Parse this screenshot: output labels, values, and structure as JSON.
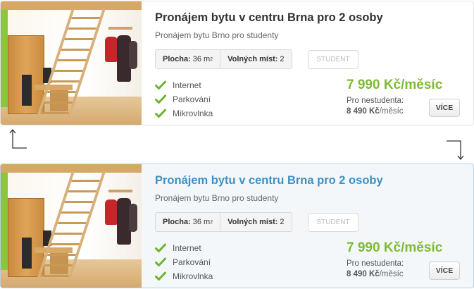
{
  "listings": [
    {
      "state": "normal",
      "title": "Pronájem bytu v centru Brna pro 2 osoby",
      "subtitle": "Pronájem bytu Brno pro studenty",
      "specs": {
        "area_label": "Plocha:",
        "area_value": "36 m",
        "area_unit_sup": "2",
        "free_label": "Volných míst:",
        "free_value": "2"
      },
      "badge": "STUDENT",
      "amenities": [
        "Internet",
        "Parkování",
        "Mikrovlnka"
      ],
      "price": "7 990 Kč/měsíc",
      "nonstudent_label": "Pro nestudenta:",
      "nonstudent_price": "8 490 Kč",
      "nonstudent_suffix": "/měsíc",
      "more_button": "VÍCE"
    },
    {
      "state": "hover",
      "title": "Pronájem bytu v centru Brna pro 2 osoby",
      "subtitle": "Pronájem bytu Brno pro studenty",
      "specs": {
        "area_label": "Plocha:",
        "area_value": "36 m",
        "area_unit_sup": "2",
        "free_label": "Volných míst:",
        "free_value": "2"
      },
      "badge": "STUDENT",
      "amenities": [
        "Internet",
        "Parkování",
        "Mikrovlnka"
      ],
      "price": "7 990 Kč/měsíc",
      "nonstudent_label": "Pro nestudenta:",
      "nonstudent_price": "8 490 Kč",
      "nonstudent_suffix": "/měsíc",
      "more_button": "VÍCE"
    }
  ],
  "icons": {
    "amenity": "check-icon",
    "transition_left": "arrow-up-left-icon",
    "transition_right": "arrow-down-right-icon"
  },
  "colors": {
    "price_green": "#7dbb33",
    "check_green": "#6ab42d",
    "hover_title_blue": "#3f8fc4",
    "hover_background": "#f3f7fa"
  }
}
